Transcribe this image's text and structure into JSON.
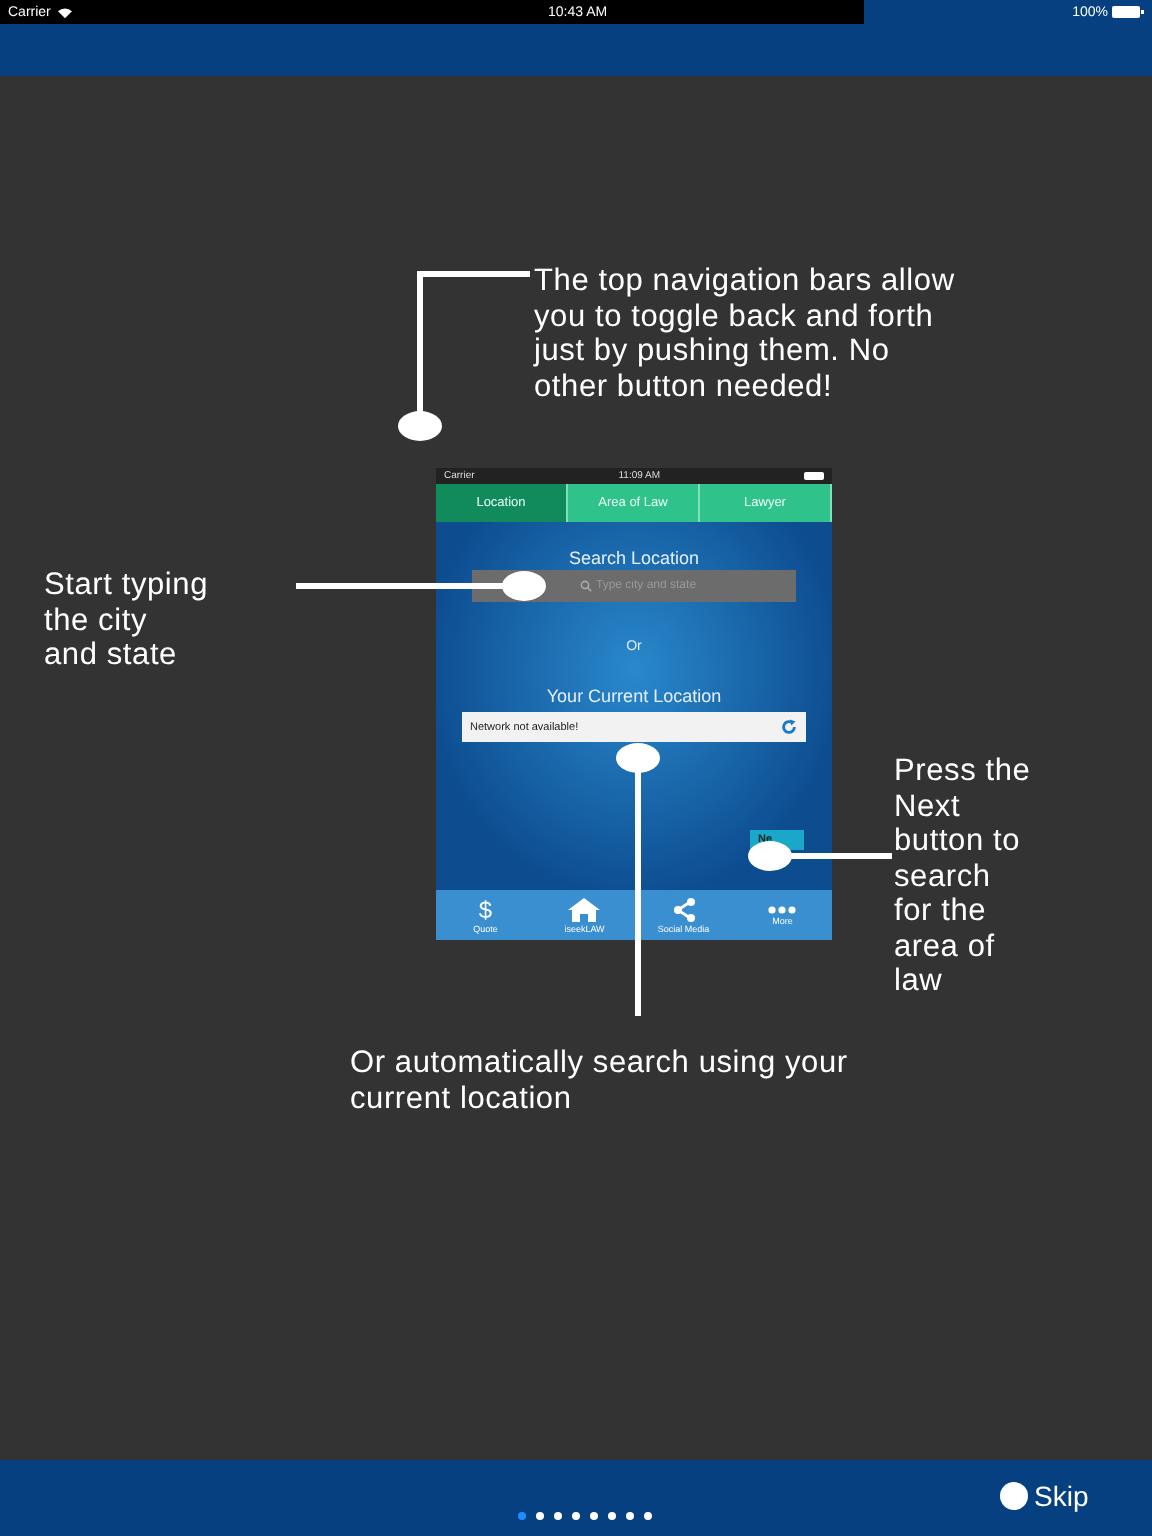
{
  "status_bar": {
    "carrier": "Carrier",
    "time": "10:43 AM",
    "battery": "100%"
  },
  "phone_screen": {
    "carrier": "Carrier",
    "time": "11:09 AM",
    "nav_tabs": [
      {
        "label": "Location",
        "selected": true
      },
      {
        "label": "Area of Law",
        "selected": false
      },
      {
        "label": "Lawyer",
        "selected": false
      }
    ],
    "search_label": "Search Location",
    "search_placeholder": "Type city and state",
    "or_label": "Or",
    "current_location_label": "Your Current Location",
    "current_location_value": "Network not available!",
    "next_button": "Ne",
    "tab_bar": [
      {
        "kind": "glyph",
        "glyph": "$",
        "label": "Quote"
      },
      {
        "kind": "home",
        "label": "iseekLAW"
      },
      {
        "kind": "share",
        "label": "Social Media"
      },
      {
        "kind": "more",
        "label": "More"
      }
    ]
  },
  "callouts": [
    {
      "kind": "nav",
      "text": "The top navigation bars allow\nyou to toggle back and forth\njust by pushing them. No\nother button needed!"
    },
    {
      "kind": "search",
      "text": "Start typing\nthe city\nand state"
    },
    {
      "kind": "next",
      "text": "Press the\nNext\nbutton to\nsearch\nfor the\narea of\nlaw"
    },
    {
      "kind": "location",
      "text": "Or automatically search using your\ncurrent location"
    }
  ],
  "page_dots": [
    {
      "selected": true
    },
    {
      "selected": false
    },
    {
      "selected": false
    },
    {
      "selected": false
    },
    {
      "selected": false
    },
    {
      "selected": false
    },
    {
      "selected": false
    },
    {
      "selected": false
    }
  ],
  "skip_button": "Skip"
}
